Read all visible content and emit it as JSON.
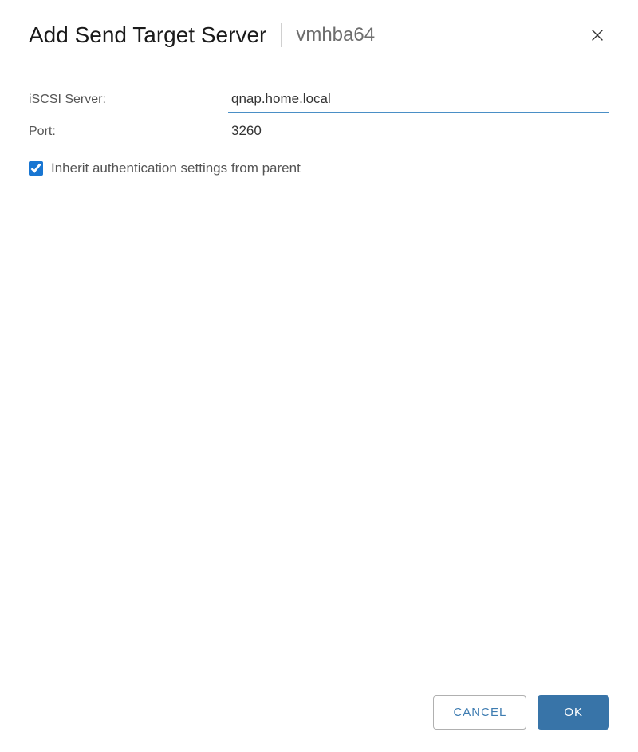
{
  "header": {
    "title": "Add Send Target Server",
    "subtitle": "vmhba64"
  },
  "form": {
    "iscsi_label": "iSCSI Server:",
    "iscsi_value": "qnap.home.local",
    "port_label": "Port:",
    "port_value": "3260",
    "inherit_label": "Inherit authentication settings from parent"
  },
  "footer": {
    "cancel_label": "CANCEL",
    "ok_label": "OK"
  }
}
